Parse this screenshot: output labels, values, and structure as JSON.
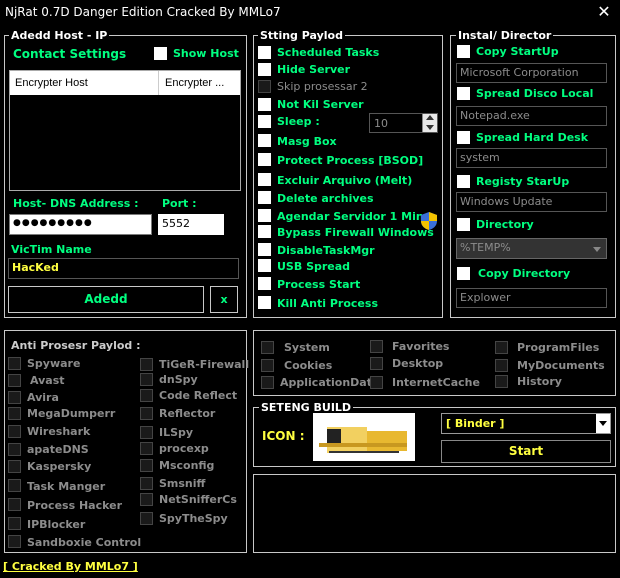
{
  "window": {
    "title": "NjRat 0.7D Danger Edition Cracked By MMLo7",
    "close_glyph": "✕"
  },
  "host": {
    "legend": "Adedd Host - IP",
    "contact_settings": "Contact Settings",
    "show_host": "Show Host",
    "table_headers": [
      "Encrypter Host",
      "Encrypter ..."
    ],
    "dns_label": "Host- DNS Address :",
    "dns_value": "●●●●●●●●●",
    "port_label": "Port :",
    "port_value": "5552",
    "victim_label": "VicTim Name",
    "victim_value": "HacKed",
    "add_button": "Adedd",
    "remove_button": "x"
  },
  "payload": {
    "legend": "Stting Paylod",
    "items": [
      {
        "label": "Scheduled Tasks",
        "enabled": true
      },
      {
        "label": "Hide Server",
        "enabled": true
      },
      {
        "label": "Skip prosessar 2",
        "enabled": false
      },
      {
        "label": "Not Kil Server",
        "enabled": true
      },
      {
        "label": "Sleep  :",
        "enabled": true
      },
      {
        "label": "Masg Box",
        "enabled": true
      },
      {
        "label": "Protect Process [BSOD]",
        "enabled": true
      },
      {
        "label": "Excluir Arquivo (Melt)",
        "enabled": true
      },
      {
        "label": "Delete archives",
        "enabled": true
      },
      {
        "label": "Agendar Servidor 1 Min.",
        "enabled": true
      },
      {
        "label": "Bypass Firewall Windows",
        "enabled": true
      },
      {
        "label": "DisableTaskMgr",
        "enabled": true
      },
      {
        "label": "USB Spread",
        "enabled": true
      },
      {
        "label": "Process Start",
        "enabled": true
      },
      {
        "label": "Kill Anti Process",
        "enabled": true
      }
    ],
    "sleep_value": "10"
  },
  "install": {
    "legend": "Instal/ Director",
    "copy_startup": "Copy StartUp",
    "copy_startup_value": "Microsoft Corporation",
    "spread_disco": "Spread Disco Local",
    "spread_disco_value": "Notepad.exe",
    "spread_hard": "Spread  Hard Desk",
    "spread_hard_value": "system",
    "registry": "Registy StarUp",
    "registry_value": "Windows Update",
    "directory": "Directory",
    "directory_value": "%TEMP%",
    "copy_directory": "Copy Directory",
    "copy_directory_value": "Explower"
  },
  "anti": {
    "legend": "Anti Prosesr Paylod :",
    "col1": [
      "Spyware",
      "Avast",
      "Avira",
      "MegaDumperr",
      "Wireshark",
      "apateDNS",
      "Kaspersky",
      "Task Manger",
      "Process Hacker",
      "IPBlocker",
      "Sandboxie Control"
    ],
    "col2": [
      "TiGeR-Firewall",
      "dnSpy",
      "Code Reflect",
      "Reflector",
      "ILSpy",
      "procexp",
      "Msconfig",
      "Smsniff",
      "NetSnifferCs",
      "SpyTheSpy"
    ]
  },
  "folders": {
    "col1": [
      "System",
      "Cookies",
      "ApplicationData"
    ],
    "col2": [
      "Favorites",
      "Desktop",
      "InternetCache"
    ],
    "col3": [
      "ProgramFiles",
      "MyDocuments",
      "History"
    ]
  },
  "build": {
    "legend": "SETENG BUILD",
    "icon_label": "ICON :",
    "binder_value": "[ Binder  ]",
    "start_button": "Start"
  },
  "footer": {
    "credit": "[ Cracked By MMLo7 ]"
  }
}
